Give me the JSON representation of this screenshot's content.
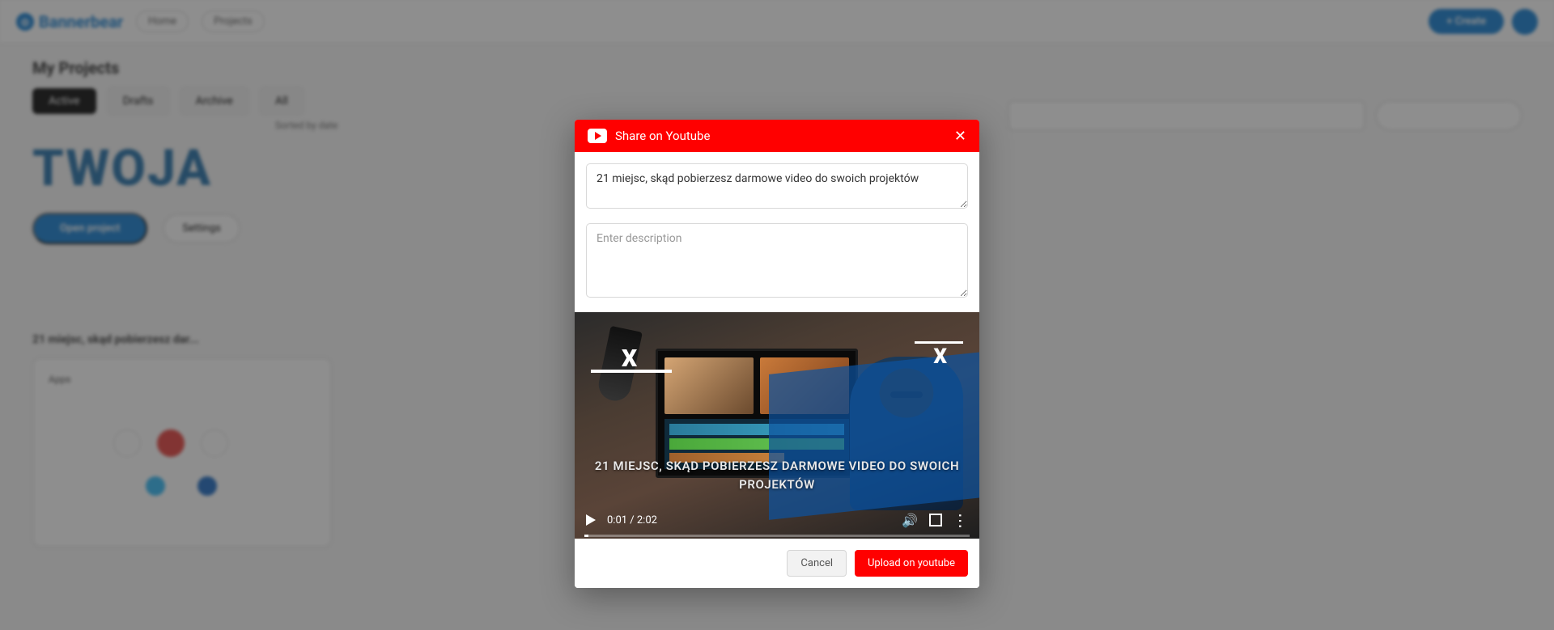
{
  "modal": {
    "title": "Share on Youtube",
    "video_title_value": "21 miejsc, skąd pobierzesz darmowe video do swoich projektów",
    "desc_placeholder": "Enter description",
    "cancel": "Cancel",
    "upload": "Upload on youtube",
    "time": "0:01 / 2:02",
    "overlay_text": "21 MIEJSC, SKĄD POBIERZESZ DARMOWE VIDEO DO SWOICH PROJEKTÓW",
    "x_l": "X",
    "x_r": "X"
  },
  "bg": {
    "logo": "Bannerbear",
    "pill1": "Home",
    "pill2": "Projects",
    "create": "+ Create",
    "heading": "My Projects",
    "tab_black": "Active",
    "tab1": "Drafts",
    "tab2": "Archive",
    "tab3": "All",
    "subline": "Sorted by date",
    "twoja": "TWOJA",
    "primary_long": "Open project",
    "ghost": "Settings",
    "section2": "21 miejsc, skąd pobierzesz dar...",
    "card_head": "Apps"
  }
}
